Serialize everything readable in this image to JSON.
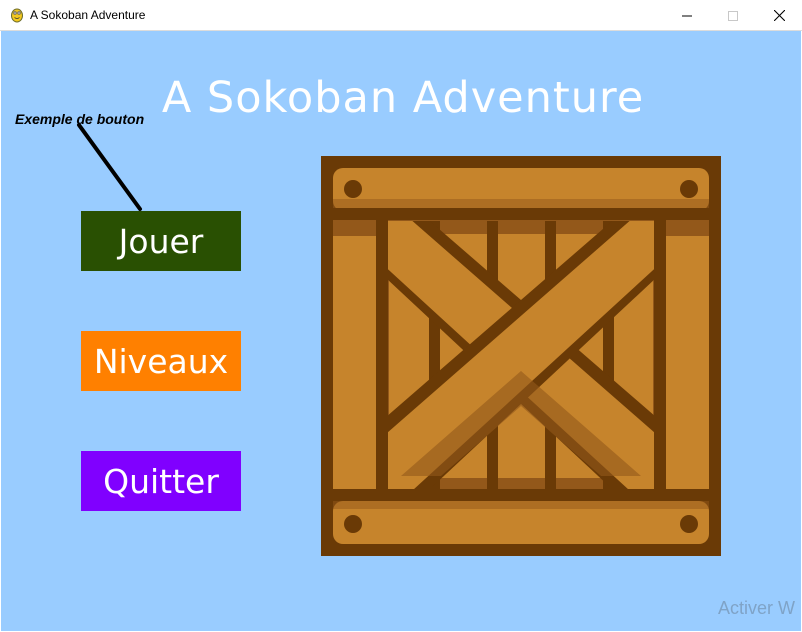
{
  "window": {
    "title": "A Sokoban Adventure",
    "app_icon": "pygame-snake-icon",
    "controls": [
      "minimize-icon",
      "maximize-icon",
      "close-icon"
    ]
  },
  "game": {
    "background_color": "#99ccff",
    "title": "A Sokoban Adventure",
    "example_label": "Exemple de bouton",
    "buttons": [
      {
        "label": "Jouer",
        "color": "#295002"
      },
      {
        "label": "Niveaux",
        "color": "#ff8000"
      },
      {
        "label": "Quitter",
        "color": "#8000ff"
      }
    ],
    "crate_image": "wooden-crate",
    "watermark": "Activer W"
  },
  "colors": {
    "crate_dark": "#6a3a06",
    "crate_wood": "#c6842c",
    "crate_shadow": "#93581a"
  }
}
